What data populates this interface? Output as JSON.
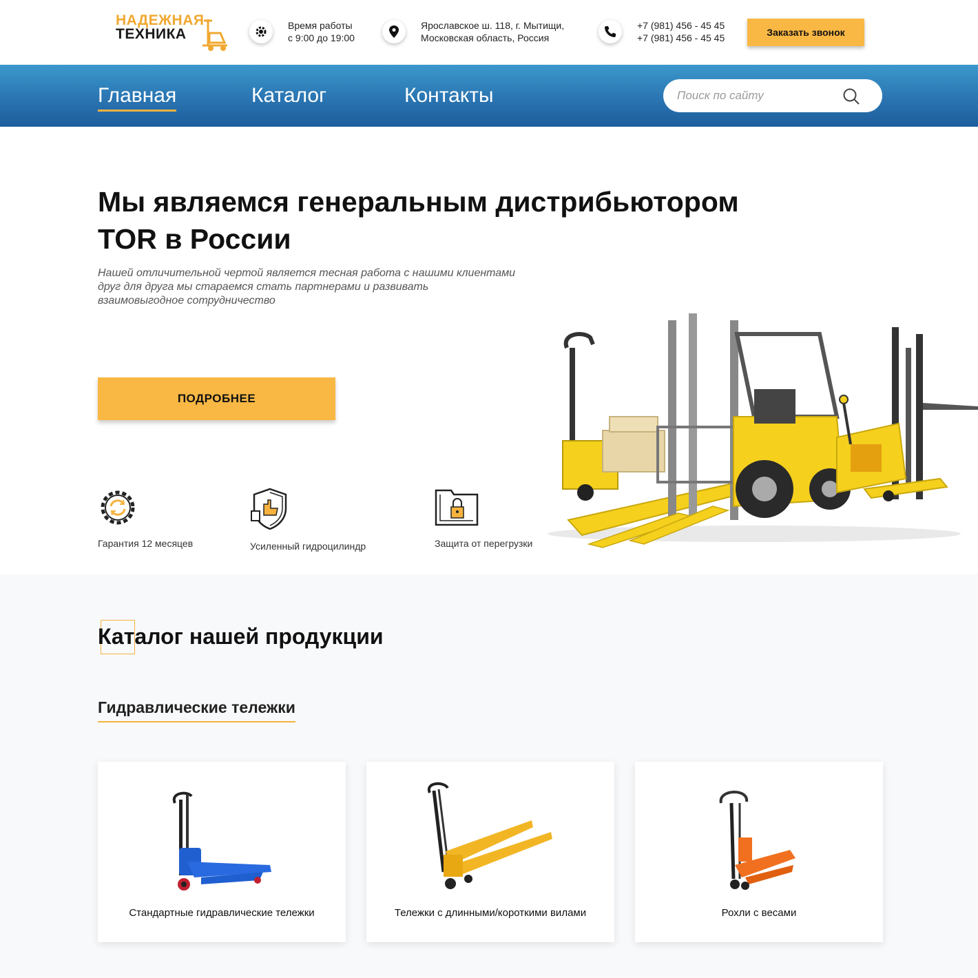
{
  "brand": {
    "line1": "НАДЕЖНАЯ",
    "line2": "ТЕХНИКА"
  },
  "header": {
    "hours_line1": "Время работы",
    "hours_line2": "с 9:00 до 19:00",
    "address_line1": "Ярославское ш. 118, г. Мытищи,",
    "address_line2": "Московская область, Россия",
    "phone1": "+7 (981) 456 - 45 45",
    "phone2": "+7 (981) 456 - 45 45",
    "callback_label": "Заказать звонок"
  },
  "nav": {
    "items": [
      {
        "label": "Главная"
      },
      {
        "label": "Каталог"
      },
      {
        "label": "Контакты"
      }
    ],
    "search_placeholder": "Поиск по сайту"
  },
  "hero": {
    "title_line1": "Мы являемся генеральным дистрибьютором",
    "title_line2": "TOR в России",
    "sub_line1": "Нашей отличительной чертой является тесная работа с нашими клиентами",
    "sub_line2": "друг для друга мы стараемся стать партнерами и развивать",
    "sub_line3": "взаимовыгодное сотрудничество",
    "button_label": "ПОДРОБНЕЕ",
    "features": [
      {
        "label": "Гарантия 12 месяцев",
        "icon": "gear-refresh-icon"
      },
      {
        "label": "Усиленный гидроцилиндр",
        "icon": "shield-hand-icon"
      },
      {
        "label": "Защита от перегрузки",
        "icon": "folder-lock-icon"
      }
    ]
  },
  "catalog": {
    "title": "Каталог нашей продукции",
    "subtitle": "Гидравлические тележки",
    "cards": [
      {
        "label": "Стандартные гидравлические тележки"
      },
      {
        "label": "Тележки с длинными/короткими вилами"
      },
      {
        "label": "Рохли с весами"
      }
    ]
  },
  "colors": {
    "accent": "#f9b844",
    "nav_top": "#3b98cc",
    "nav_bottom": "#1e5d9c",
    "forklift_yellow": "#f5d01d"
  }
}
